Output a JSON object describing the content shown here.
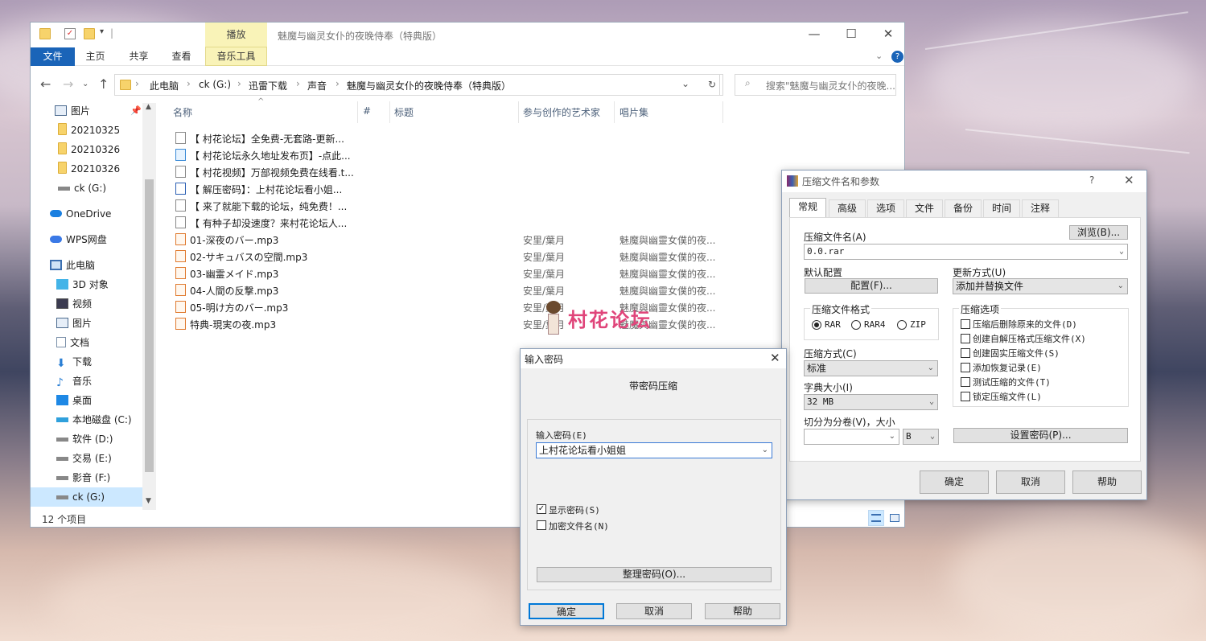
{
  "explorer": {
    "window_title": "魅魔与幽灵女仆的夜晚侍奉（特典版）",
    "context_tab": "播放",
    "ribbon_tabs": {
      "file": "文件",
      "home": "主页",
      "share": "共享",
      "view": "查看",
      "music_tools": "音乐工具"
    },
    "breadcrumb": [
      "此电脑",
      "ck (G:)",
      "迅雷下载",
      "声音",
      "魅魔与幽灵女仆的夜晚侍奉（特典版）"
    ],
    "search_placeholder": "搜索\"魅魔与幽灵女仆的夜晚...",
    "nav": [
      {
        "label": "图片",
        "icon": "pictures-icon"
      },
      {
        "label": "20210325",
        "icon": "folder-icon"
      },
      {
        "label": "20210326",
        "icon": "folder-icon"
      },
      {
        "label": "20210326",
        "icon": "folder-icon"
      },
      {
        "label": "ck (G:)",
        "icon": "drive-icon"
      },
      {
        "label": "OneDrive",
        "icon": "cloud-icon"
      },
      {
        "label": "WPS网盘",
        "icon": "cloud-icon"
      },
      {
        "label": "此电脑",
        "icon": "pc-icon"
      },
      {
        "label": "3D 对象",
        "icon": "3d-icon"
      },
      {
        "label": "视频",
        "icon": "video-icon"
      },
      {
        "label": "图片",
        "icon": "pictures-icon"
      },
      {
        "label": "文档",
        "icon": "documents-icon"
      },
      {
        "label": "下载",
        "icon": "download-icon"
      },
      {
        "label": "音乐",
        "icon": "music-icon"
      },
      {
        "label": "桌面",
        "icon": "desktop-icon"
      },
      {
        "label": "本地磁盘 (C:)",
        "icon": "drive-icon"
      },
      {
        "label": "软件 (D:)",
        "icon": "drive-icon"
      },
      {
        "label": "交易 (E:)",
        "icon": "drive-icon"
      },
      {
        "label": "影音 (F:)",
        "icon": "drive-icon"
      },
      {
        "label": "ck (G:)",
        "icon": "drive-icon"
      }
    ],
    "columns": {
      "name": "名称",
      "number": "#",
      "title": "标题",
      "artist": "参与创作的艺术家",
      "album": "唱片集"
    },
    "files": [
      {
        "name": "【 村花论坛】全免费-无套路-更新...",
        "artist": "",
        "album": "",
        "type": "text"
      },
      {
        "name": "【 村花论坛永久地址发布页】-点此...",
        "artist": "",
        "album": "",
        "type": "link"
      },
      {
        "name": "【 村花视频】万部视频免费在线看.t...",
        "artist": "",
        "album": "",
        "type": "text"
      },
      {
        "name": "【 解压密码】：上村花论坛看小姐...",
        "artist": "",
        "album": "",
        "type": "doc"
      },
      {
        "name": "【 来了就能下载的论坛，纯免费！...",
        "artist": "",
        "album": "",
        "type": "text"
      },
      {
        "name": "【 有种子却没速度？来村花论坛人...",
        "artist": "",
        "album": "",
        "type": "text"
      },
      {
        "name": "01-深夜のバー.mp3",
        "artist": "安里/葉月",
        "album": "魅魔與幽靈女僕的夜...",
        "type": "mp3"
      },
      {
        "name": "02-サキュバスの空間.mp3",
        "artist": "安里/葉月",
        "album": "魅魔與幽靈女僕的夜...",
        "type": "mp3"
      },
      {
        "name": "03-幽霊メイド.mp3",
        "artist": "安里/葉月",
        "album": "魅魔與幽靈女僕的夜...",
        "type": "mp3"
      },
      {
        "name": "04-人間の反撃.mp3",
        "artist": "安里/葉月",
        "album": "魅魔與幽靈女僕的夜...",
        "type": "mp3"
      },
      {
        "name": "05-明け方のバー.mp3",
        "artist": "安里/葉月",
        "album": "魅魔與幽靈女僕的夜...",
        "type": "mp3"
      },
      {
        "name": "特典-現実の夜.mp3",
        "artist": "安里/葉月",
        "album": "魅魔與幽靈女僕的夜...",
        "type": "mp3"
      }
    ],
    "status": "12 个项目"
  },
  "rar": {
    "title": "压缩文件名和参数",
    "help_mark": "?",
    "tabs": [
      "常规",
      "高级",
      "选项",
      "文件",
      "备份",
      "时间",
      "注释"
    ],
    "archive_name_label": "压缩文件名(A)",
    "browse_label": "浏览(B)...",
    "archive_name_value": "0.0.rar",
    "default_profile_label": "默认配置",
    "profile_button": "配置(F)...",
    "update_mode_label": "更新方式(U)",
    "update_mode_value": "添加并替换文件",
    "format_label": "压缩文件格式",
    "formats": [
      "RAR",
      "RAR4",
      "ZIP"
    ],
    "options_label": "压缩选项",
    "options": [
      "压缩后删除原来的文件(D)",
      "创建自解压格式压缩文件(X)",
      "创建固实压缩文件(S)",
      "添加恢复记录(E)",
      "测试压缩的文件(T)",
      "锁定压缩文件(L)"
    ],
    "method_label": "压缩方式(C)",
    "method_value": "标准",
    "dict_label": "字典大小(I)",
    "dict_value": "32 MB",
    "split_label": "切分为分卷(V)，大小",
    "split_value": "",
    "split_unit": "B",
    "set_password": "设置密码(P)...",
    "ok": "确定",
    "cancel": "取消",
    "help": "帮助"
  },
  "pwd": {
    "title": "输入密码",
    "heading": "带密码压缩",
    "field_label": "输入密码(E)",
    "field_value": "上村花论坛看小姐姐",
    "show_password": "显示密码(S)",
    "encrypt_names": "加密文件名(N)",
    "organize": "整理密码(O)...",
    "ok": "确定",
    "cancel": "取消",
    "help": "帮助"
  },
  "watermark": "村花论坛",
  "colors": {
    "accent": "#1a64b8",
    "selected": "#cce8ff",
    "context_tab": "#f9f3b8",
    "watermark": "#e0457a"
  }
}
